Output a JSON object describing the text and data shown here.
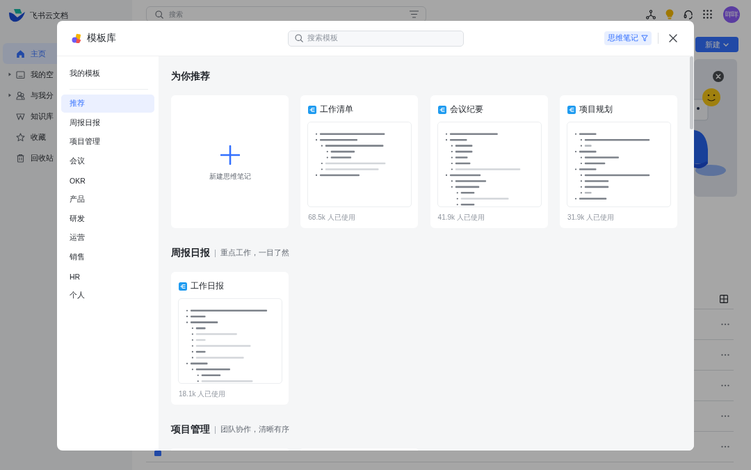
{
  "app": {
    "title": "飞书云文档",
    "nav": [
      {
        "label": "主页",
        "selected": true,
        "expandable": false
      },
      {
        "label": "我的空",
        "selected": false,
        "expandable": true
      },
      {
        "label": "与我分",
        "selected": false,
        "expandable": true
      },
      {
        "label": "知识库",
        "selected": false,
        "expandable": false
      },
      {
        "label": "收藏",
        "selected": false,
        "expandable": false
      },
      {
        "label": "回收站",
        "selected": false,
        "expandable": false
      }
    ],
    "search": {
      "placeholder": "搜索"
    },
    "avatar": "咩咩",
    "new_button": "新建"
  },
  "template_library": {
    "title": "模板库",
    "search": {
      "placeholder": "搜索模板"
    },
    "filter_tag": "思维笔记",
    "my_templates": {
      "label": "我的模板",
      "selected": false
    },
    "categories": [
      {
        "label": "推荐",
        "selected": true
      },
      {
        "label": "周报日报",
        "selected": false
      },
      {
        "label": "项目管理",
        "selected": false
      },
      {
        "label": "会议",
        "selected": false
      },
      {
        "label": "OKR",
        "selected": false
      },
      {
        "label": "产品",
        "selected": false
      },
      {
        "label": "研发",
        "selected": false
      },
      {
        "label": "运营",
        "selected": false
      },
      {
        "label": "销售",
        "selected": false
      },
      {
        "label": "HR",
        "selected": false
      },
      {
        "label": "个人",
        "selected": false
      }
    ],
    "sections": [
      {
        "title": "为你推荐",
        "cards": [
          {
            "kind": "new",
            "label": "新建思维笔记"
          },
          {
            "kind": "template",
            "title": "工作清单",
            "usage": "68.5k 人已使用"
          },
          {
            "kind": "template",
            "title": "会议纪要",
            "usage": "41.9k 人已使用"
          },
          {
            "kind": "template",
            "title": "项目规划",
            "usage": "31.9k 人已使用"
          }
        ]
      },
      {
        "title": "周报日报",
        "subtitle": "重点工作，一目了然",
        "cards": [
          {
            "kind": "template",
            "title": "工作日报",
            "usage": "18.1k 人已使用"
          }
        ]
      },
      {
        "title": "项目管理",
        "subtitle": "团队协作，清晰有序",
        "cards": [
          {
            "kind": "blank"
          },
          {
            "kind": "blank"
          }
        ]
      }
    ]
  }
}
